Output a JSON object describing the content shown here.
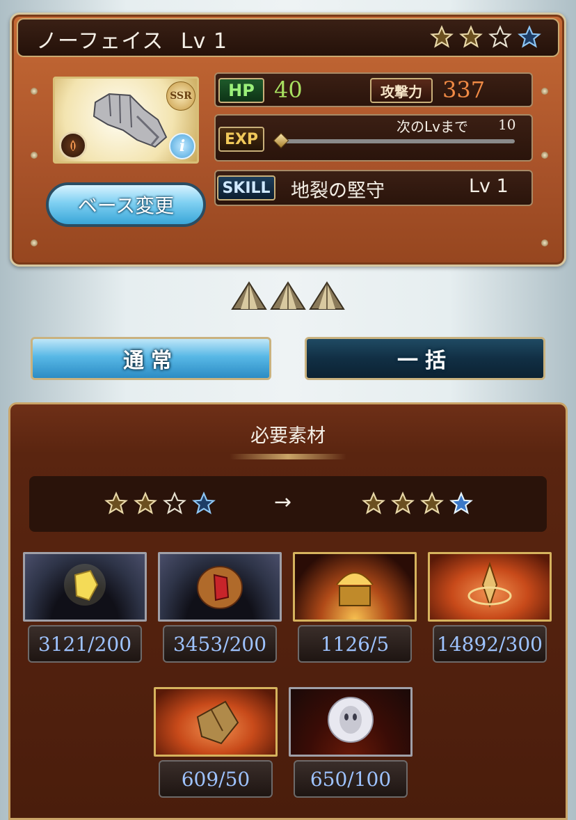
{
  "header": {
    "name": "ノーフェイス",
    "level": "Lv 1",
    "stars_filled": 2,
    "stars_total": 4
  },
  "stats": {
    "hp_label": "HP",
    "hp_value": "40",
    "atk_label": "攻撃力",
    "atk_value": "337",
    "exp_label": "EXP",
    "exp_next_label": "次のLvまで",
    "exp_next_value": "10",
    "exp_progress": 0.0,
    "skill_label": "SKILL",
    "skill_name": "地裂の堅守",
    "skill_level": "Lv 1"
  },
  "portrait": {
    "rarity": "SSR",
    "icon": "gauntlet-icon",
    "element": "earth"
  },
  "buttons": {
    "base_change": "ベース変更",
    "tab_normal": "通常",
    "tab_bulk": "一括"
  },
  "materials": {
    "title": "必要素材",
    "arrow": "→",
    "from_stars": 2,
    "to_stars": 3,
    "total_stars": 4,
    "items": [
      {
        "icon": "yellow-crystal-icon",
        "count": "3121/200"
      },
      {
        "icon": "red-crystal-icon",
        "count": "3453/200"
      },
      {
        "icon": "golden-chest-icon",
        "count": "1126/5"
      },
      {
        "icon": "golden-sword-icon",
        "count": "14892/300"
      },
      {
        "icon": "rock-fragment-icon",
        "count": "609/50"
      },
      {
        "icon": "mask-orb-icon",
        "count": "650/100"
      }
    ]
  },
  "colors": {
    "hp_value": "#a8e060",
    "atk_value": "#f08a45",
    "count_text": "#9ec3ff",
    "tab_active": "#5fc0ec",
    "tab_inactive": "#16374b"
  }
}
